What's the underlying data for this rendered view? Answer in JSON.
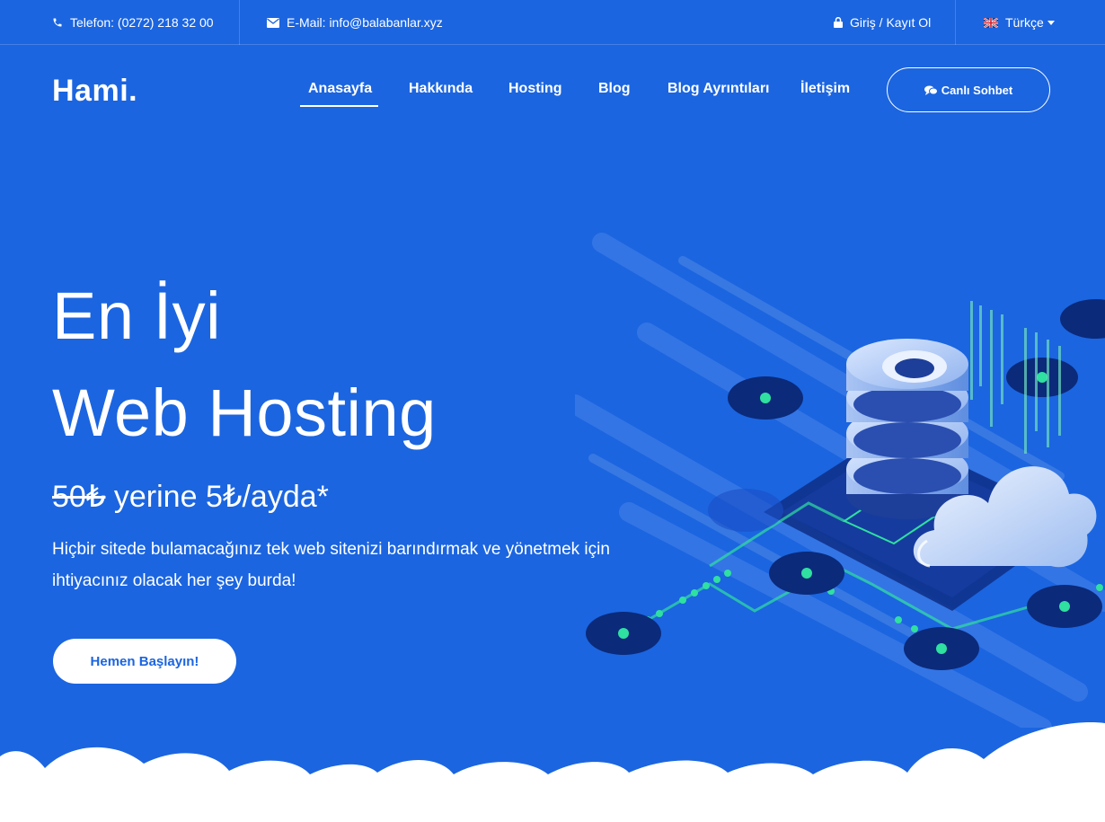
{
  "topbar": {
    "phone": "Telefon: (0272) 218 32 00",
    "email": "E-Mail: info@balabanlar.xyz",
    "login": "Giriş / Kayıt Ol",
    "language": "Türkçe"
  },
  "nav": {
    "logo": "Hami.",
    "links": [
      "Anasayfa",
      "Hakkında",
      "Hosting",
      "Blog",
      "Blog Ayrıntıları",
      "İletişim"
    ],
    "active": "Anasayfa",
    "chat_label": "Canlı Sohbet"
  },
  "hero": {
    "title_line1": "En İyi",
    "title_line2": "Web Hosting",
    "old_price": "50₺",
    "price_rest": " yerine 5₺/ayda*",
    "description": "Hiçbir sitede bulamacağınız tek web sitenizi barındırmak ve yönetmek için ihtiyacınız olacak her şey burda!",
    "cta_label": "Hemen Başlayın!"
  },
  "icons": [
    "phone-icon",
    "envelope-icon",
    "lock-icon",
    "flag-icon",
    "chevron-down-icon",
    "chat-icon"
  ],
  "colors": {
    "background": "#1b65e0",
    "accent": "#2fe0a0",
    "white": "#ffffff"
  }
}
